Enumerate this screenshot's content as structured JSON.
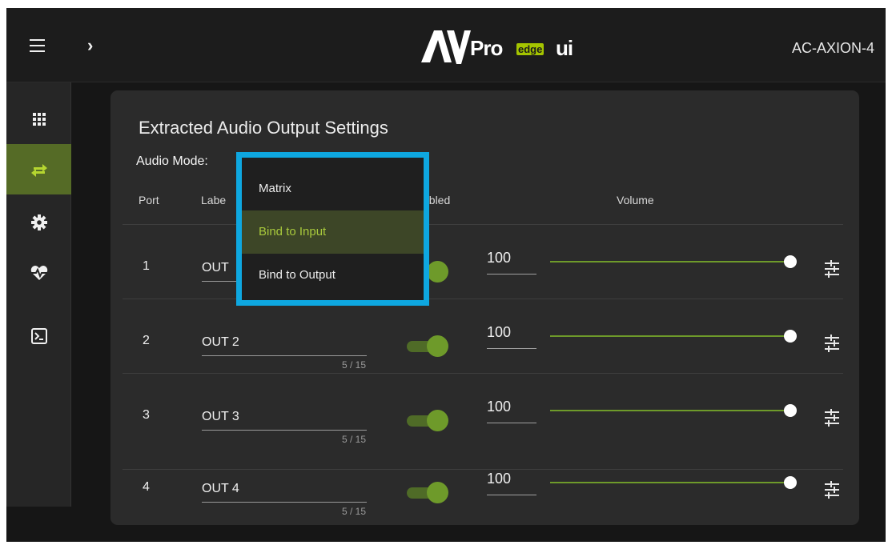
{
  "header": {
    "logo_av": "AV",
    "logo_pro": "Pro",
    "logo_edge": "edge",
    "logo_ui": "ui",
    "device_name": "AC-AXION-4"
  },
  "sidebar": {
    "items": [
      {
        "icon": "grid-icon",
        "active": false
      },
      {
        "icon": "swap-arrows-icon",
        "active": true
      },
      {
        "icon": "gear-icon",
        "active": false
      },
      {
        "icon": "heart-pulse-icon",
        "active": false
      },
      {
        "icon": "terminal-icon",
        "active": false
      }
    ]
  },
  "card": {
    "title": "Extracted Audio Output Settings",
    "audio_mode_label": "Audio Mode:",
    "columns": {
      "port": "Port",
      "label": "Labe",
      "enabled": "abled",
      "volume": "Volume"
    },
    "rows": [
      {
        "port": "1",
        "label": "OUT",
        "counter": "",
        "enabled": true,
        "volume": "100",
        "volume_level": 1.0
      },
      {
        "port": "2",
        "label": "OUT 2",
        "counter": "5 / 15",
        "enabled": true,
        "volume": "100",
        "volume_level": 1.0
      },
      {
        "port": "3",
        "label": "OUT 3",
        "counter": "5 / 15",
        "enabled": true,
        "volume": "100",
        "volume_level": 1.0
      },
      {
        "port": "4",
        "label": "OUT 4",
        "counter": "5 / 15",
        "enabled": true,
        "volume": "100",
        "volume_level": 1.0
      }
    ]
  },
  "dropdown": {
    "options": [
      "Matrix",
      "Bind to Input",
      "Bind to Output"
    ],
    "selected": "Bind to Input"
  },
  "colors": {
    "accent_green": "#6e9a2a",
    "highlight_blue": "#0ea7e0",
    "logo_green": "#a4c400"
  }
}
